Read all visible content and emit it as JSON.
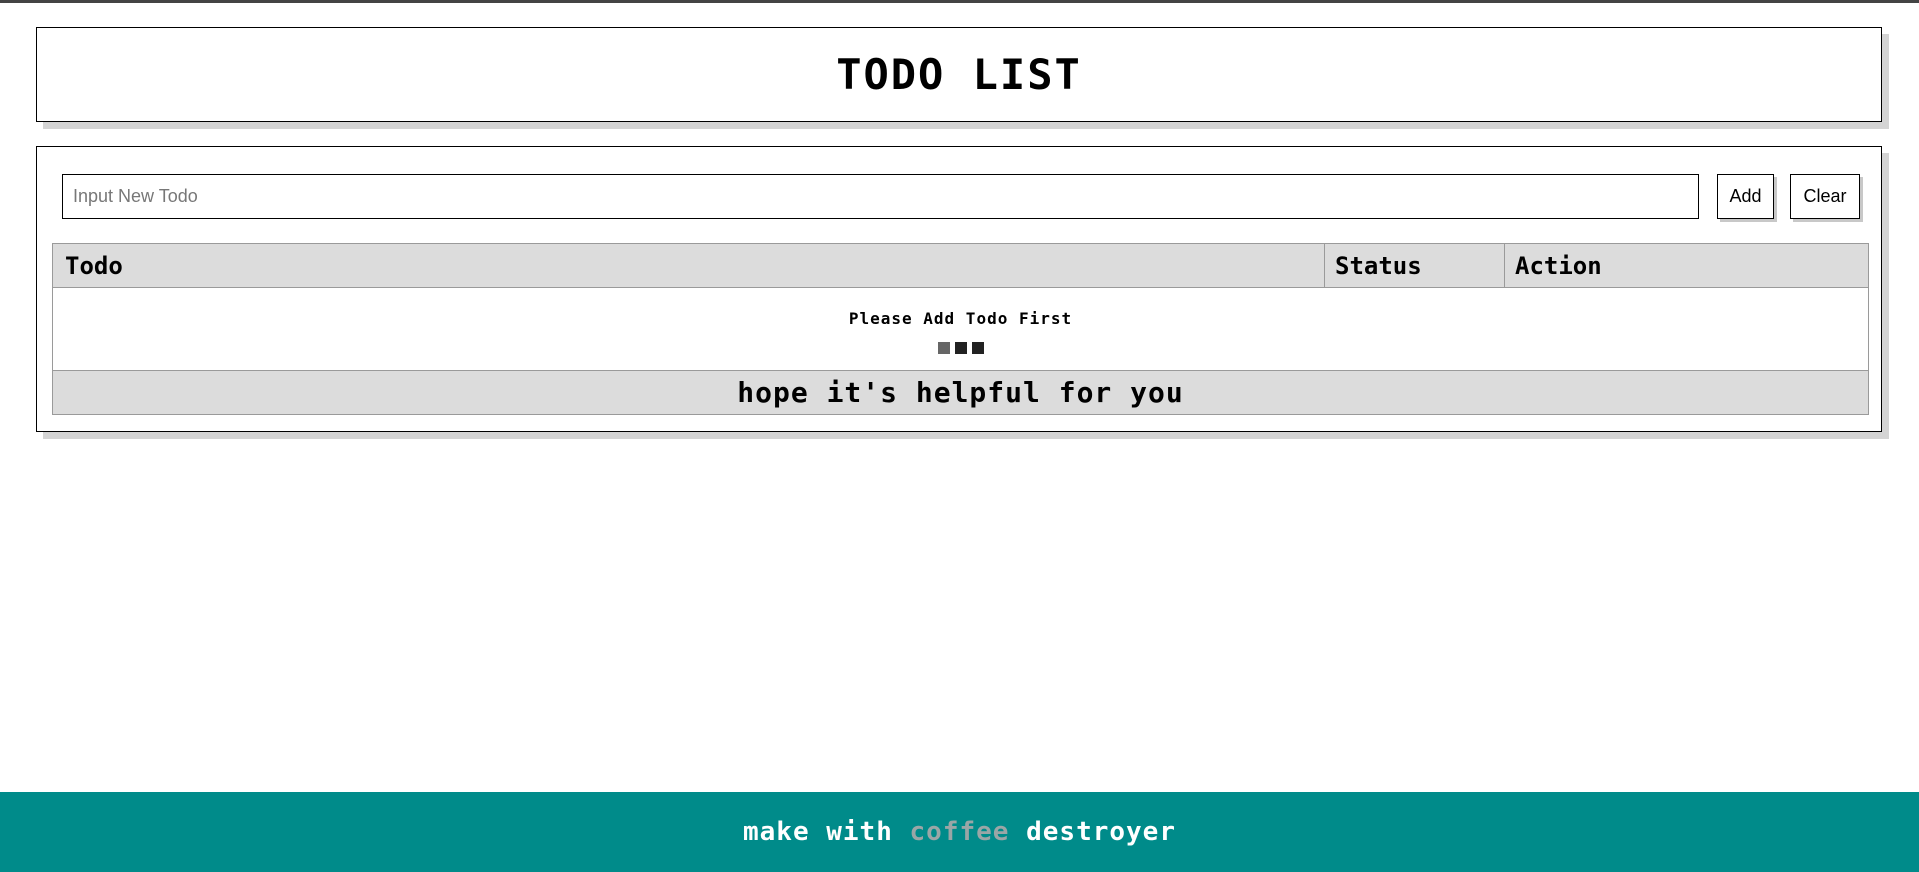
{
  "header": {
    "title": "TODO LIST"
  },
  "form": {
    "input_placeholder": "Input New Todo",
    "input_value": "",
    "add_label": "Add",
    "clear_label": "Clear"
  },
  "table": {
    "columns": [
      "Todo",
      "Status",
      "Action"
    ],
    "rows": [],
    "empty_message": "Please Add Todo First",
    "loading_dot_colors": [
      "#666666",
      "#222222",
      "#222222"
    ],
    "footer_text": "hope it's helpful for you"
  },
  "footer": {
    "prefix": "make with ",
    "accent_word": "coffee",
    "suffix": " destroyer",
    "background_color": "#008b8a",
    "accent_color": "#9aa6a6"
  }
}
